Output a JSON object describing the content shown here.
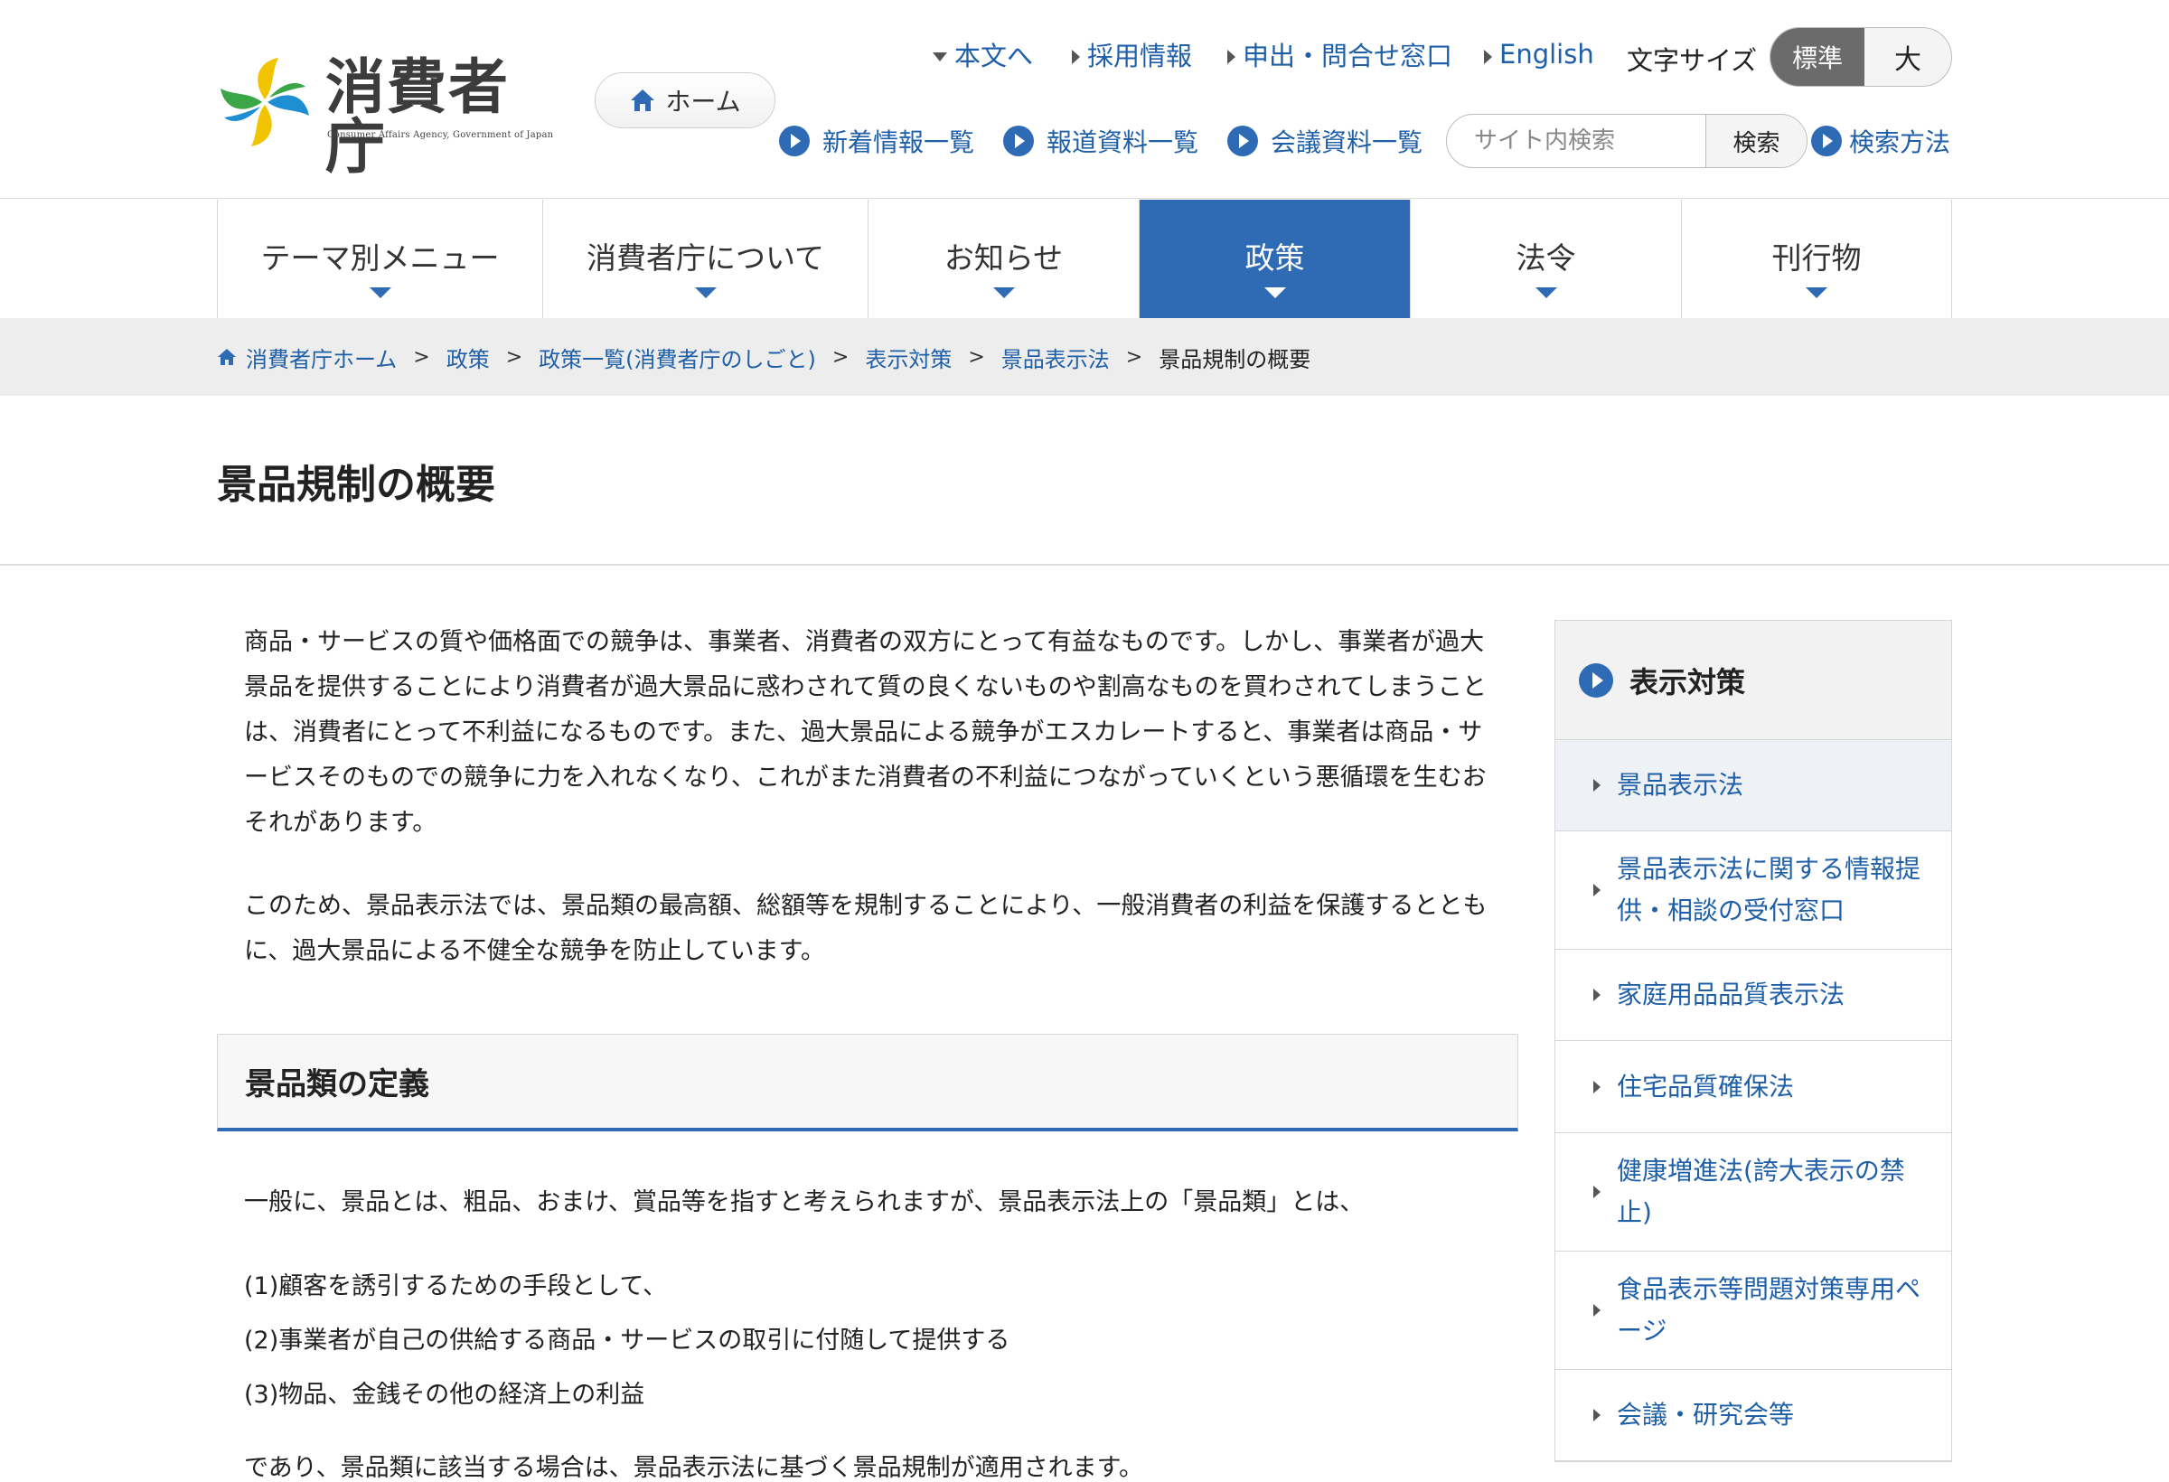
{
  "header": {
    "logo_text": "消費者庁",
    "logo_sub": "Consumer Affairs Agency, Government of Japan",
    "home_label": "ホーム",
    "top_links": [
      "本文へ",
      "採用情報",
      "申出・問合せ窓口",
      "English"
    ],
    "font_size_label": "文字サイズ",
    "font_size_standard": "標準",
    "font_size_large": "大",
    "sub_links": [
      "新着情報一覧",
      "報道資料一覧",
      "会議資料一覧"
    ],
    "search_placeholder": "サイト内検索",
    "search_button": "検索",
    "search_help": "検索方法"
  },
  "gnav": {
    "items": [
      "テーマ別メニュー",
      "消費者庁について",
      "お知らせ",
      "政策",
      "法令",
      "刊行物"
    ],
    "active": "政策"
  },
  "breadcrumb": {
    "items": [
      "消費者庁ホーム",
      "政策",
      "政策一覧(消費者庁のしごと)",
      "表示対策",
      "景品表示法"
    ],
    "current": "景品規制の概要"
  },
  "page": {
    "title": "景品規制の概要",
    "paragraphs": [
      "商品・サービスの質や価格面での競争は、事業者、消費者の双方にとって有益なものです。しかし、事業者が過大景品を提供することにより消費者が過大景品に惑わされて質の良くないものや割高なものを買わされてしまうことは、消費者にとって不利益になるものです。また、過大景品による競争がエスカレートすると、事業者は商品・サービスそのものでの競争に力を入れなくなり、これがまた消費者の不利益につながっていくという悪循環を生むおそれがあります。",
      "このため、景品表示法では、景品類の最高額、総額等を規制することにより、一般消費者の利益を保護するとともに、過大景品による不健全な競争を防止しています。"
    ],
    "section_title": "景品類の定義",
    "section_intro": "一般に、景品とは、粗品、おまけ、賞品等を指すと考えられますが、景品表示法上の「景品類」とは、",
    "section_list": [
      "(1)顧客を誘引するための手段として、",
      "(2)事業者が自己の供給する商品・サービスの取引に付随して提供する",
      "(3)物品、金銭その他の経済上の利益"
    ],
    "section_after": "であり、景品類に該当する場合は、景品表示法に基づく景品規制が適用されます。"
  },
  "sidebar": {
    "title": "表示対策",
    "items": [
      "景品表示法",
      "景品表示法に関する情報提供・相談の受付窓口",
      "家庭用品品質表示法",
      "住宅品質確保法",
      "健康増進法(誇大表示の禁止)",
      "食品表示等問題対策専用ページ",
      "会議・研究会等"
    ],
    "current": "景品表示法"
  },
  "colors": {
    "accent": "#2f6bb5",
    "link": "#1f5fa8",
    "breadcrumb_bg": "#ededed"
  },
  "icons": [
    "home-icon",
    "triangle-down-icon",
    "triangle-right-icon",
    "circle-arrow-icon",
    "logo-pinwheel-icon"
  ]
}
